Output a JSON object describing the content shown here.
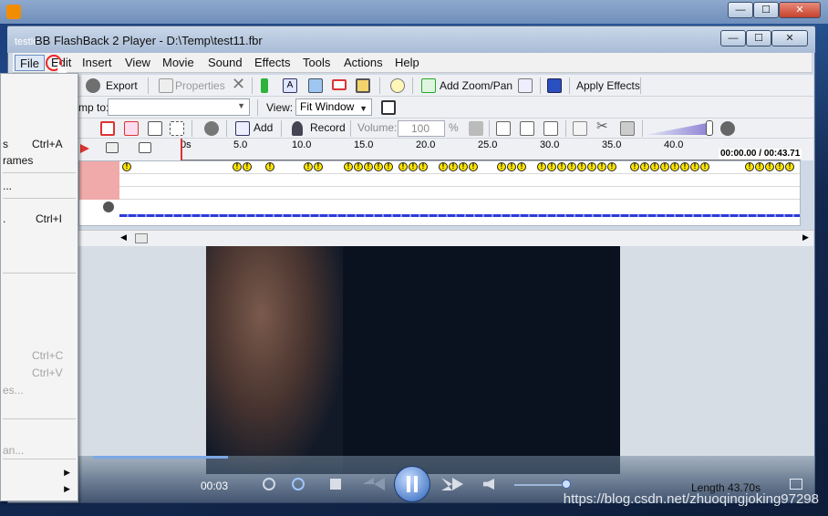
{
  "app": {
    "outer_title": "testlo",
    "inner_title": "BB FlashBack 2 Player - D:\\Temp\\test11.fbr",
    "window_controls": [
      "minimize",
      "maximize",
      "close"
    ]
  },
  "menu": [
    "File",
    "Edit",
    "Insert",
    "View",
    "Movie",
    "Sound",
    "Effects",
    "Tools",
    "Actions",
    "Help"
  ],
  "toolbar1": {
    "export": "Export",
    "properties": "Properties",
    "add_zoom_pan": "Add Zoom/Pan",
    "apply_effects": "Apply Effects"
  },
  "toolbar2": {
    "jump_label": "mp to:",
    "jump_value": "",
    "view_label": "View:",
    "view_value": "Fit Window"
  },
  "toolbar3": {
    "add": "Add",
    "record": "Record",
    "volume_label": "Volume:",
    "volume_value": "100",
    "volume_unit": "%"
  },
  "ruler": {
    "ticks": [
      "0s",
      "5.0",
      "10.0",
      "15.0",
      "20.0",
      "25.0",
      "30.0",
      "35.0",
      "40.0"
    ],
    "position": "00:00.00 / 00:43.71"
  },
  "dropdown": {
    "items": [
      {
        "label": "s",
        "shortcut": "Ctrl+A",
        "disabled": false
      },
      {
        "label": "rames",
        "shortcut": "",
        "disabled": false
      },
      {
        "label": "...",
        "shortcut": "",
        "disabled": false
      },
      {
        "label": ".",
        "shortcut": "Ctrl+I",
        "disabled": false
      },
      {
        "label": "",
        "shortcut": "Ctrl+C",
        "disabled": true
      },
      {
        "label": "",
        "shortcut": "Ctrl+V",
        "disabled": true
      },
      {
        "label": "es...",
        "shortcut": "",
        "disabled": true
      },
      {
        "label": "an...",
        "shortcut": "",
        "disabled": true
      }
    ]
  },
  "player": {
    "time": "00:03",
    "length": "Length 43.70s"
  },
  "watermark": "https://blog.csdn.net/zhuoqingjoking97298"
}
